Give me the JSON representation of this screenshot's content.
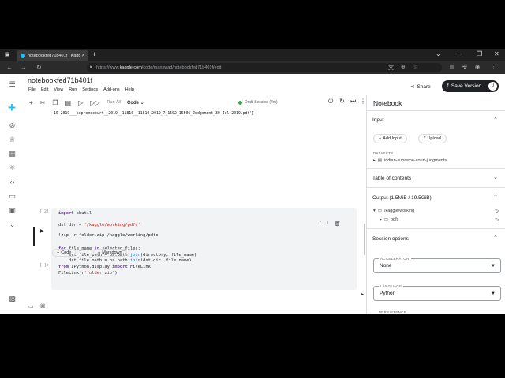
{
  "browser": {
    "tab_title": "notebookfed71b401f | Kaggle",
    "url_prefix": "https://www.",
    "url_domain": "kaggle.com",
    "url_path": "/code/manswad/notebookfed71b401f/edit"
  },
  "header": {
    "title": "notebookfed71b401f",
    "menu": [
      "File",
      "Edit",
      "View",
      "Run",
      "Settings",
      "Add-ons",
      "Help"
    ],
    "share_label": "Share",
    "save_label": "Save Version",
    "save_count": "0"
  },
  "toolbar": {
    "run_all": "Run All",
    "cell_type": "Code",
    "status": "Draft Session (4m)"
  },
  "notebook": {
    "output_line": "10-2019___supremecourt__2019__11810__11810_2019_7_1502_15506_Judgement_30-Jul-2019.pdf']",
    "cells": [
      {
        "prompt": "[ 2]:",
        "code": "import shutil\n\ndst_dir = '/kaggle/working/pdfs'\n\nos.makedirs(dst_dir, exist_ok=True)\n\nfor file_name in selected_files:\n    src_file_path = os.path.join(directory, file_name)\n    dst_file_path = os.path.join(dst_dir, file_name)\n\n    shutil.copy(src_file_path, dst_file_path)"
      },
      {
        "prompt": "",
        "code": "!zip -r folder.zip /kaggle/working/pdfs"
      },
      {
        "prompt": "[ ]:",
        "code": "from IPython.display import FileLink\nFileLink(r'folder.zip')"
      }
    ],
    "add_code": "Code",
    "add_markdown": "Markdown"
  },
  "panel": {
    "title": "Notebook",
    "input_heading": "Input",
    "add_input": "Add Input",
    "upload": "Upload",
    "datasets_label": "DATASETS",
    "dataset_name": "indian-supreme-court-judgments",
    "toc_heading": "Table of contents",
    "output_heading": "Output (1.5MiB / 19.5GiB)",
    "output_root": "/kaggle/working",
    "output_child": "pdfs",
    "session_heading": "Session options",
    "accelerator_label": "ACCELERATOR",
    "accelerator_value": "None",
    "language_label": "LANGUAGE",
    "language_value": "Python",
    "persistence_label": "PERSISTENCE"
  }
}
